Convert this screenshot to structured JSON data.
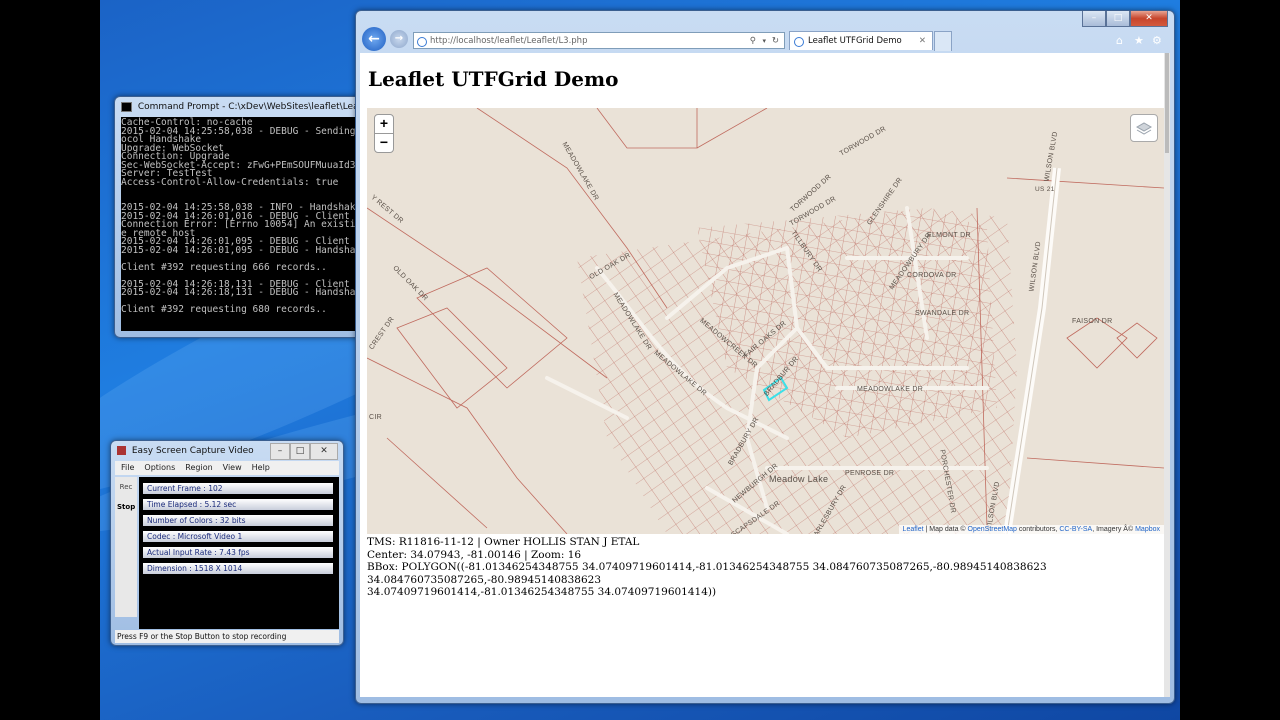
{
  "cmd": {
    "title": "Command Prompt - C:\\xDev\\WebSites\\leaflet\\Leaflet\\serv",
    "output": "Cache-Control: no-cache\n2015-02-04 14:25:58,038 - DEBUG - Sending\nocol Handshake\nUpgrade: WebSocket\nConnection: Upgrade\nSec-WebSocket-Accept: zFwG+PEmSOUFMuuaId3\nServer: TestTest\nAccess-Control-Allow-Credentials: true\n\n\n2015-02-04 14:25:58,038 - INFO - Handshak\n2015-02-04 14:26:01,016 - DEBUG - Client\nConnection Error: [Errno 10054] An existi\ne remote host\n2015-02-04 14:26:01,095 - DEBUG - Client\n2015-02-04 14:26:01,095 - DEBUG - Handsha\n\nClient #392 requesting 666 records..\n\n2015-02-04 14:26:18,131 - DEBUG - Client\n2015-02-04 14:26:18,131 - DEBUG - Handsha\n\nClient #392 requesting 680 records.."
  },
  "capture": {
    "title": "Easy Screen Capture Video",
    "menu": [
      "File",
      "Options",
      "Region",
      "View",
      "Help"
    ],
    "rec_label": "Rec",
    "stop_label": "Stop",
    "fields": [
      "Current Frame : 102",
      "Time Elapsed : 5.12 sec",
      "Number of Colors : 32 bits",
      "Codec : Microsoft Video 1",
      "Actual Input Rate : 7.43 fps",
      "Dimension : 1518 X 1014"
    ],
    "status": "Press F9 or the Stop Button to stop recording"
  },
  "browser": {
    "url": "http://localhost/leaflet/Leaflet/L3.php",
    "tab_title": "Leaflet UTFGrid Demo",
    "page_title": "Leaflet UTFGrid Demo",
    "zoom_in": "+",
    "zoom_out": "−",
    "attribution": {
      "leaflet": "Leaflet",
      "text1": " | Map data © ",
      "osm": "OpenStreetMap",
      "text2": " contributors, ",
      "license": "CC-BY-SA",
      "text3": ", Imagery Â© ",
      "mapbox": "Mapbox"
    },
    "info_line1": "TMS: R11816-11-12 | Owner HOLLIS STAN J ETAL",
    "info_line2": "Center: 34.07943, -81.00146 | Zoom: 16",
    "info_line3": "BBox: POLYGON((-81.01346254348755 34.07409719601414,-81.01346254348755 34.084760735087265,-80.98945140838623 34.084760735087265,-80.98945140838623",
    "info_line4": "34.07409719601414,-81.01346254348755 34.07409719601414))"
  },
  "map_labels": {
    "torwood": "TORWOOD DR",
    "torwood2": "TORWOOD DR",
    "torwood3": "TORWOOD DR",
    "us21": "US 21",
    "wilson1": "WILSON BLVD",
    "wilson2": "WILSON BLVD",
    "wilson3": "WILSON BLVD",
    "meadowlake1": "MEADOWLAKE DR",
    "meadowlake2": "MEADOWLAKE DR",
    "meadowlake3": "MEADOWLAKE DR",
    "meadowlake4": "MEADOWLAKE DR",
    "glenshire": "GLENSHIRE DR",
    "elmont": "ELMONT DR",
    "tillbury": "TILLBURY DR",
    "meadowbury": "MEADOWBURY DR",
    "oldoak1": "OLD OAK DR",
    "oldoak2": "OLD OAK DR",
    "cordova": "CORDOVA DR",
    "swandale": "SWANDALE DR",
    "faison": "FAISON DR",
    "meadowcreek": "MEADOWCREEK DR",
    "fairoaks": "FAIR OAKS DR",
    "bradbur": "BRADBUR DR",
    "penrose": "PENROSE DR",
    "newburgh": "NEWBURGH DR",
    "meadowlake_water": "Meadow Lake",
    "porchester": "PORCHESTER DR",
    "scapsdale": "SCAPSDALE DR",
    "marlesbury": "MARLESBURY DR",
    "ayrest": "Y REST DR",
    "cir": "CIR",
    "crest": "CREST DR",
    "braddur": "BRADBURY DR"
  }
}
